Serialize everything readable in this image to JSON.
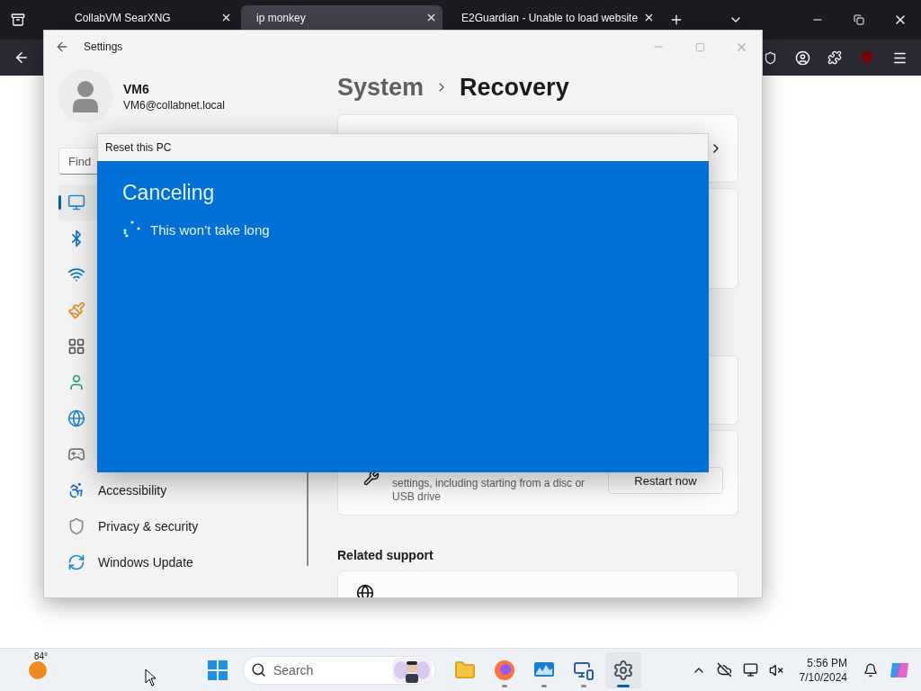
{
  "browser": {
    "tabs": [
      {
        "title": "CollabVM SearXNG",
        "selected": false
      },
      {
        "title": "ip monkey",
        "selected": true
      },
      {
        "title": "E2Guardian - Unable to load website",
        "selected": false
      }
    ]
  },
  "settings": {
    "title": "Settings",
    "user": {
      "name": "VM6",
      "email": "VM6@collabnet.local"
    },
    "search": {
      "placeholder": "Find"
    },
    "nav": [
      {
        "kind": "system",
        "selected": true
      },
      {
        "kind": "bluetooth",
        "selected": false
      },
      {
        "kind": "network",
        "selected": false
      },
      {
        "kind": "personalization",
        "selected": false
      },
      {
        "kind": "apps",
        "selected": false
      },
      {
        "kind": "accounts",
        "selected": false
      },
      {
        "kind": "time",
        "selected": false
      },
      {
        "kind": "gaming",
        "selected": false
      },
      {
        "kind": "accessibility",
        "label": "Accessibility",
        "selected": false
      },
      {
        "kind": "privacy",
        "label": "Privacy & security",
        "selected": false
      },
      {
        "kind": "update",
        "label": "Windows Update",
        "selected": false
      }
    ],
    "breadcrumb": {
      "parent": "System",
      "current": "Recovery"
    },
    "advanced_startup": {
      "description": "settings, including starting from a disc or USB drive",
      "button": "Restart now"
    },
    "related_support": "Related support"
  },
  "dialog": {
    "title": "Reset this PC",
    "heading": "Canceling",
    "status": "This won’t take long"
  },
  "taskbar": {
    "weather": "84°",
    "search": {
      "placeholder": "Search"
    },
    "apps": [
      {
        "kind": "files",
        "running": false,
        "selected": false
      },
      {
        "kind": "firefox",
        "running": true,
        "selected": false
      },
      {
        "kind": "monitor",
        "running": true,
        "selected": false
      },
      {
        "kind": "network",
        "running": true,
        "selected": false
      },
      {
        "kind": "settings",
        "running": true,
        "selected": true
      }
    ],
    "time": "5:56 PM",
    "date": "7/10/2024"
  }
}
